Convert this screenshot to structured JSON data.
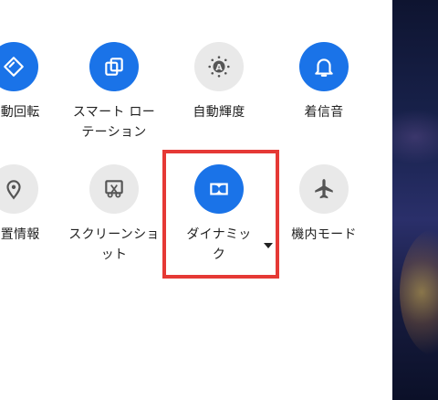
{
  "quick_settings": {
    "row1": [
      {
        "id": "auto-rotate",
        "label": "自動回転",
        "icon": "rotate-icon",
        "state": "on"
      },
      {
        "id": "smart-rotation",
        "label": "スマート ロー\nテーション",
        "icon": "smart-rotation-icon",
        "state": "on"
      },
      {
        "id": "auto-brightness",
        "label": "自動輝度",
        "icon": "auto-brightness-icon",
        "state": "off"
      },
      {
        "id": "ring",
        "label": "着信音",
        "icon": "bell-icon",
        "state": "on"
      }
    ],
    "row2": [
      {
        "id": "location",
        "label": "位置情報",
        "icon": "location-pin-icon",
        "state": "off"
      },
      {
        "id": "screenshot",
        "label": "スクリーンショ\nット",
        "icon": "screenshot-icon",
        "state": "off"
      },
      {
        "id": "dolby",
        "label": "ダイナミッ\nク",
        "icon": "dolby-icon",
        "state": "on",
        "has_dropdown": true
      },
      {
        "id": "airplane",
        "label": "機内モード",
        "icon": "airplane-icon",
        "state": "off"
      }
    ]
  },
  "colors": {
    "accent": "#1a73e8",
    "tile_off": "#e9e9e9",
    "highlight": "#e53935"
  }
}
